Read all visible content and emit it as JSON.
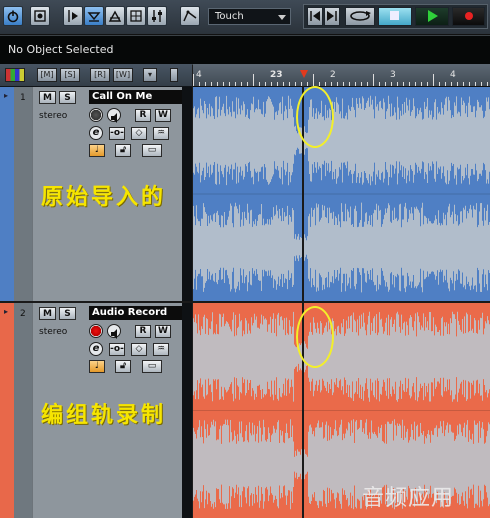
{
  "toolbar": {
    "automation_mode": "Touch"
  },
  "infoline": {
    "status": "No Object Selected"
  },
  "ruler": {
    "labels": [
      "4",
      "23",
      "2",
      "3",
      "4"
    ]
  },
  "tracks": [
    {
      "number": "1",
      "name": "Call On Me",
      "channel": "stereo",
      "annotation": "原始导入的",
      "color": "#4f7fc4"
    },
    {
      "number": "2",
      "name": "Audio Record",
      "channel": "stereo",
      "annotation": "编组轨录制",
      "color": "#e8684a"
    }
  ],
  "buttons": {
    "mute": "M",
    "solo": "S",
    "read": "R",
    "write": "W",
    "edit": "e"
  },
  "watermark": "音频应用",
  "colors": {
    "track1_wave_bg": "#4f7fc4",
    "track2_wave_bg": "#ea6a4a",
    "waveform": "#bcc4cc",
    "highlight_circle": "#f3ef2a",
    "annotation_text": "#f6e500"
  }
}
